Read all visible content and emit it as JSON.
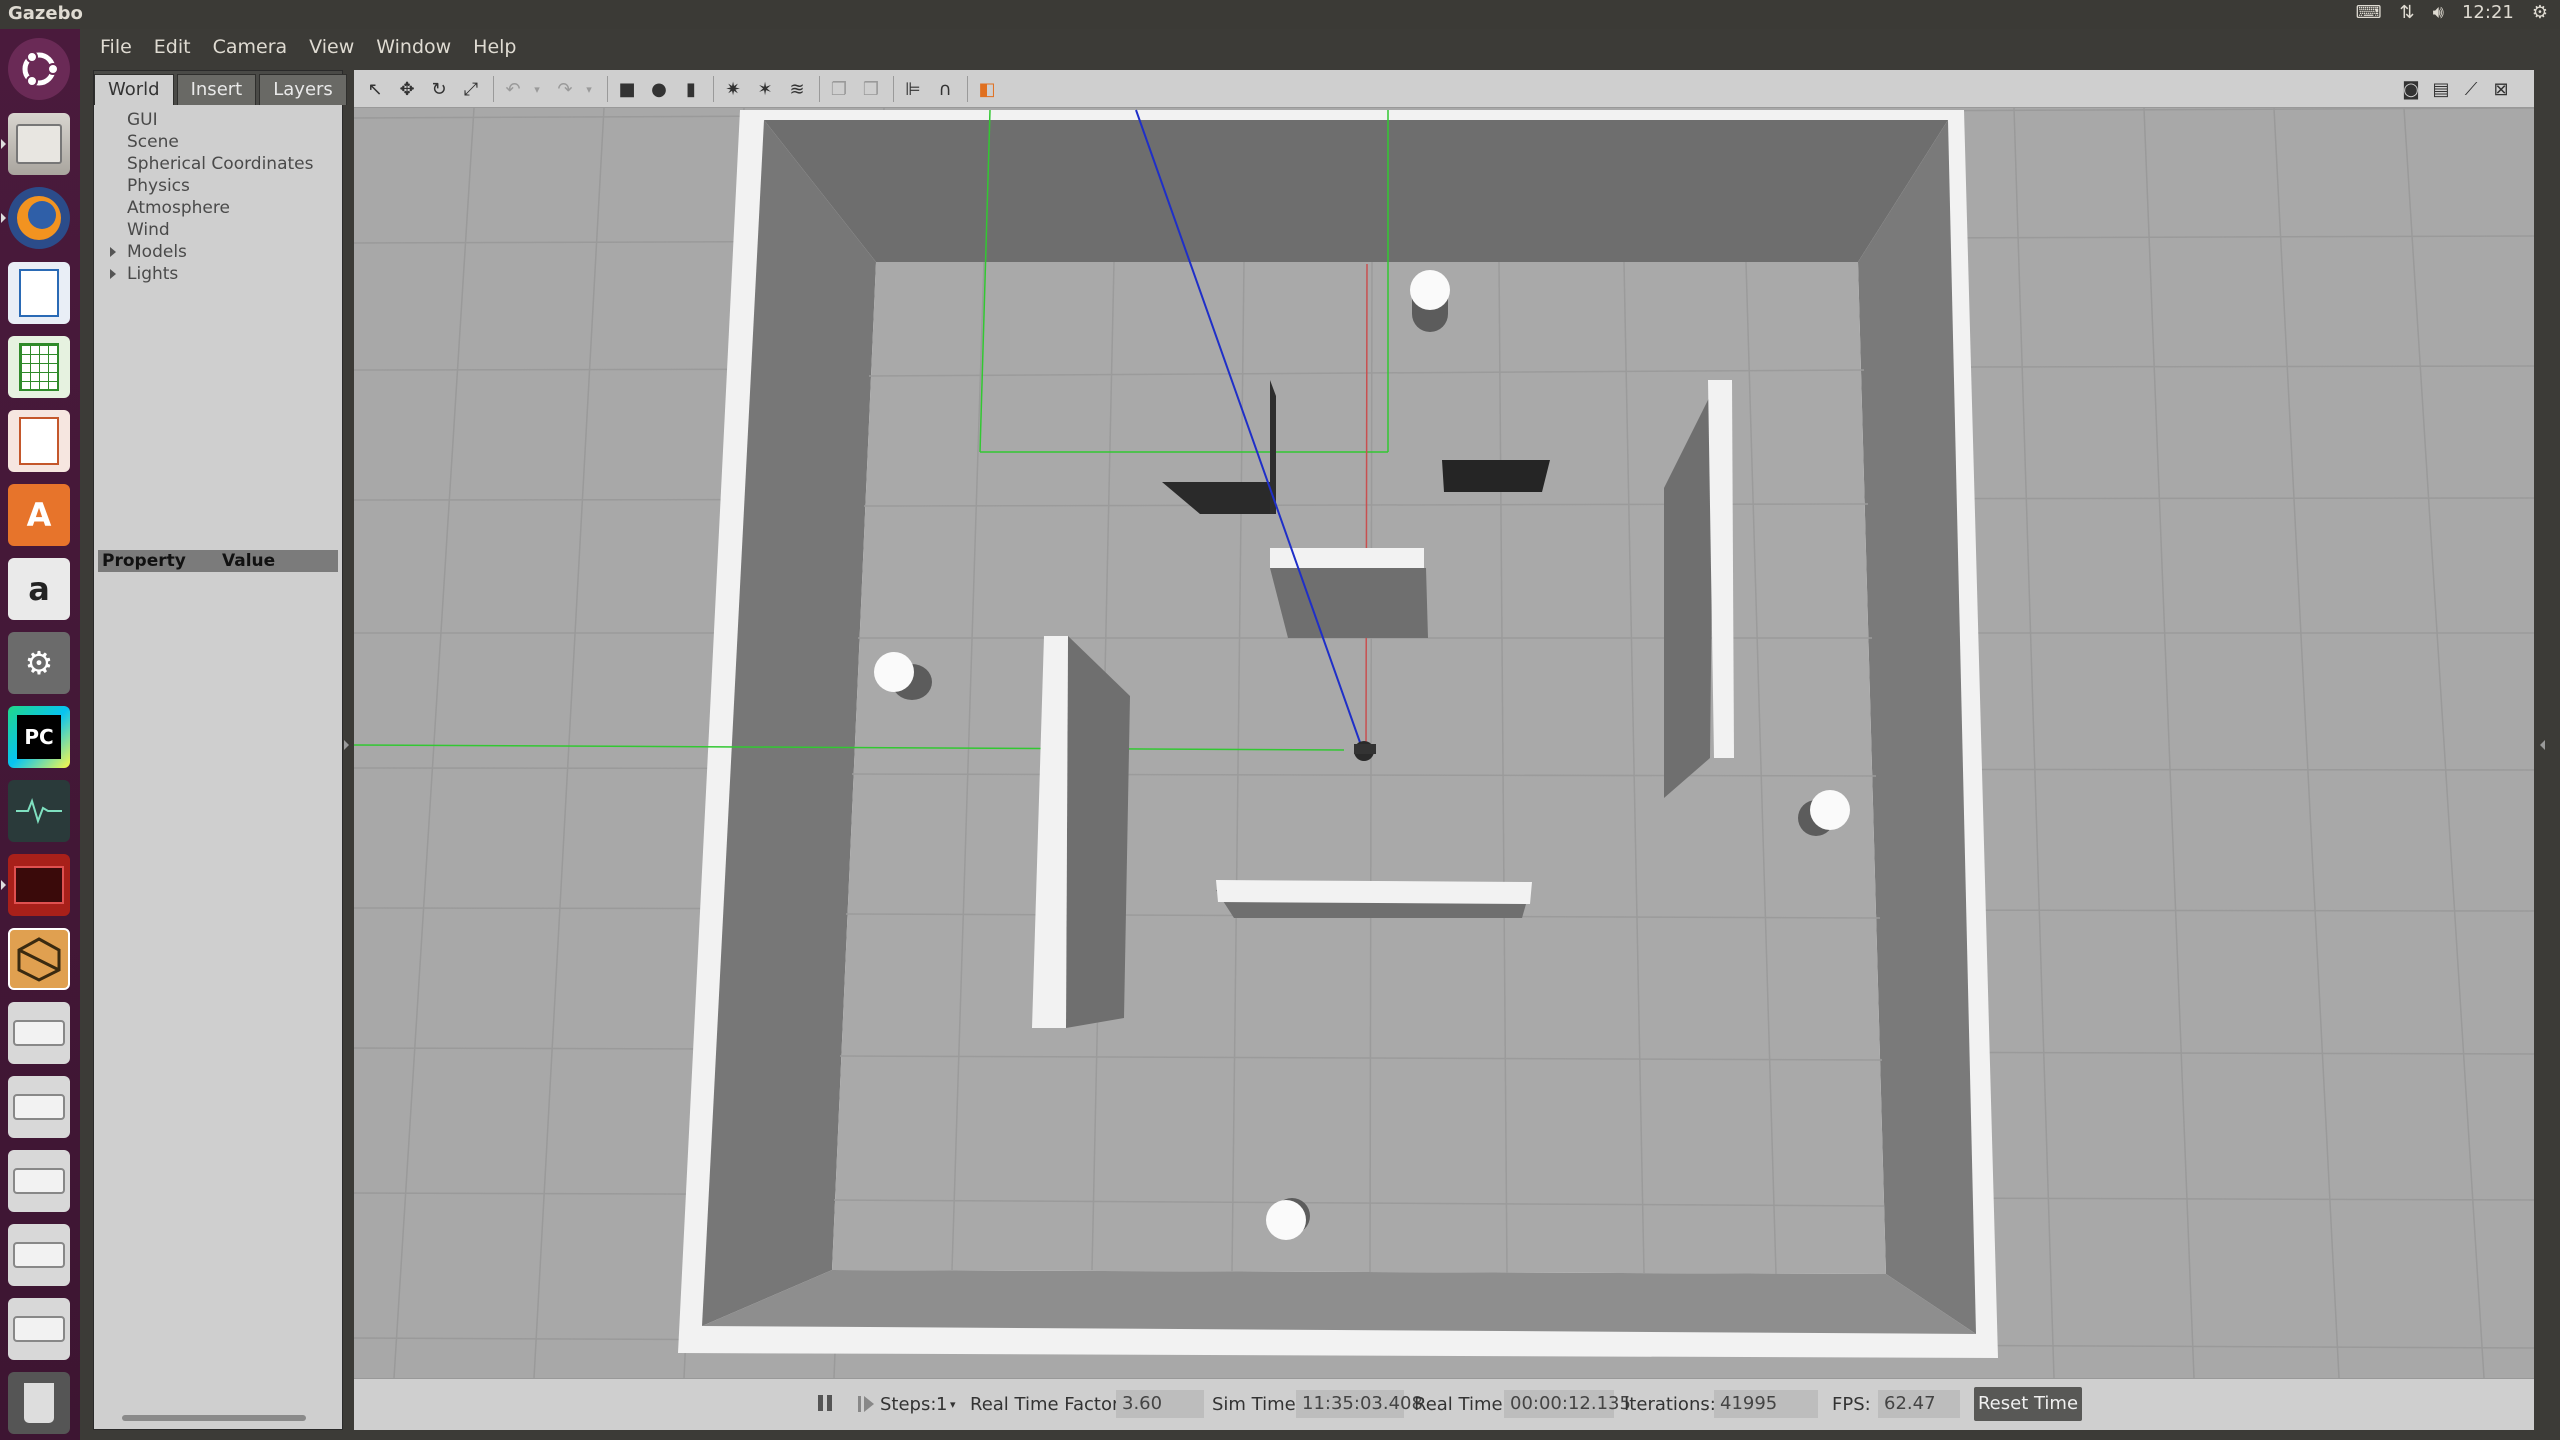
{
  "app": {
    "title": "Gazebo"
  },
  "system_tray": {
    "clock": "12:21",
    "icons": [
      "keyboard-icon",
      "network-icon",
      "volume-icon",
      "power-gear-icon"
    ]
  },
  "launcher": {
    "items": [
      "ubuntu-dash-icon",
      "files-icon",
      "firefox-icon",
      "libreoffice-writer-icon",
      "libreoffice-calc-icon",
      "libreoffice-impress-icon",
      "software-center-icon",
      "amazon-icon",
      "system-settings-icon",
      "pycharm-icon",
      "system-monitor-icon",
      "gnome-terminal-icon",
      "gazebo-icon",
      "drive-icon",
      "drive-icon",
      "drive-icon",
      "drive-icon",
      "drive-icon",
      "trash-icon"
    ],
    "amazon_letter": "a",
    "pycharm_letters": "PC"
  },
  "menubar": {
    "items": [
      "File",
      "Edit",
      "Camera",
      "View",
      "Window",
      "Help"
    ]
  },
  "left_panel": {
    "tabs": [
      "World",
      "Insert",
      "Layers"
    ],
    "active_tab": "World",
    "tree": [
      {
        "label": "GUI",
        "expandable": false
      },
      {
        "label": "Scene",
        "expandable": false
      },
      {
        "label": "Spherical Coordinates",
        "expandable": false
      },
      {
        "label": "Physics",
        "expandable": false
      },
      {
        "label": "Atmosphere",
        "expandable": false
      },
      {
        "label": "Wind",
        "expandable": false
      },
      {
        "label": "Models",
        "expandable": true
      },
      {
        "label": "Lights",
        "expandable": true
      }
    ],
    "property_header": {
      "property": "Property",
      "value": "Value"
    }
  },
  "toolbar": {
    "tools": [
      "select-arrow-icon",
      "translate-icon",
      "rotate-icon",
      "scale-icon",
      "undo-icon",
      "undo-history-icon",
      "redo-icon",
      "redo-history-icon",
      "box-shape-icon",
      "sphere-shape-icon",
      "cylinder-shape-icon",
      "point-light-icon",
      "spot-light-icon",
      "directional-light-icon",
      "copy-icon",
      "paste-icon",
      "align-icon",
      "snap-magnet-icon",
      "view-angle-icon"
    ],
    "right_tools": [
      "screenshot-icon",
      "log-icon",
      "plot-icon",
      "close-panel-icon"
    ]
  },
  "status": {
    "steps_label": "Steps:",
    "steps_value": "1",
    "real_time_factor_label": "Real Time Factor:",
    "real_time_factor": "3.60",
    "sim_time_label": "Sim Time:",
    "sim_time": "11:35:03.408",
    "real_time_label": "Real Time:",
    "real_time": "00:00:12.135",
    "iterations_label": "Iterations:",
    "iterations": "41995",
    "fps_label": "FPS:",
    "fps": "62.47",
    "reset_time_label": "Reset Time"
  },
  "colors": {
    "ground": "#a8a8a8",
    "grid_line": "#9a9a9a",
    "wall_outer_top": "#f2f2f2",
    "wall_inner": "#6e6e6e",
    "sensor_ray": "#1f2fc8",
    "x_axis_green": "#32c832",
    "z_axis_red": "#c85050",
    "launcher_bg": "#4a1a3c"
  }
}
